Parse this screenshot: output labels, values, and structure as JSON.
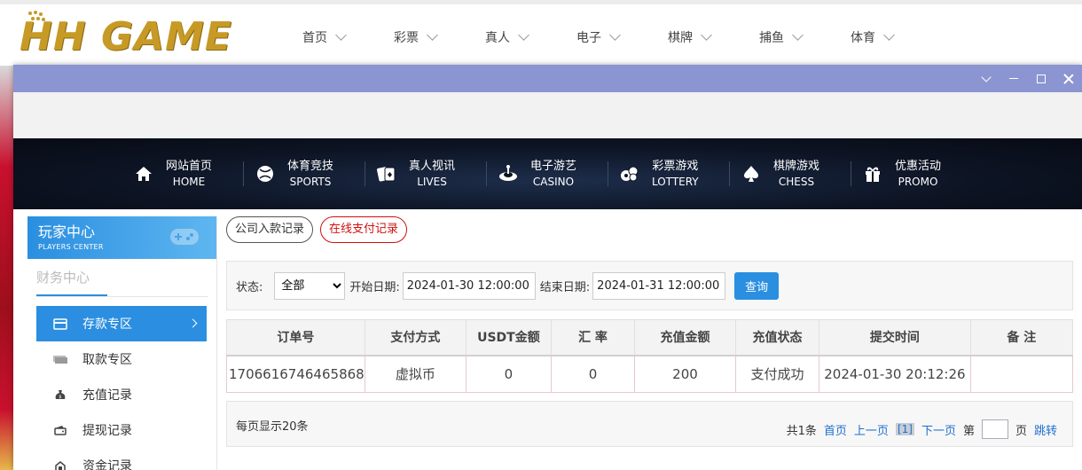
{
  "header": {
    "logo_text": "HH GAME",
    "nav": [
      "首页",
      "彩票",
      "真人",
      "电子",
      "棋牌",
      "捕鱼",
      "体育"
    ]
  },
  "main_nav": [
    {
      "cn": "网站首页",
      "en": "HOME",
      "icon": "home-icon"
    },
    {
      "cn": "体育竞技",
      "en": "SPORTS",
      "icon": "ball-icon"
    },
    {
      "cn": "真人视讯",
      "en": "LIVES",
      "icon": "cards-icon"
    },
    {
      "cn": "电子游艺",
      "en": "CASINO",
      "icon": "slot-icon"
    },
    {
      "cn": "彩票游戏",
      "en": "LOTTERY",
      "icon": "lottery-balls-icon"
    },
    {
      "cn": "棋牌游戏",
      "en": "CHESS",
      "icon": "spade-icon"
    },
    {
      "cn": "优惠活动",
      "en": "PROMO",
      "icon": "gift-icon"
    }
  ],
  "sidebar": {
    "title": "玩家中心",
    "subtitle": "PLAYERS CENTER",
    "section": "财务中心",
    "items": [
      {
        "label": "存款专区",
        "icon": "card-icon"
      },
      {
        "label": "取款专区",
        "icon": "money-icon"
      },
      {
        "label": "充值记录",
        "icon": "bag-icon"
      },
      {
        "label": "提现记录",
        "icon": "wallet-icon"
      },
      {
        "label": "资金记录",
        "icon": "coins-icon"
      }
    ]
  },
  "tabs": [
    "公司入款记录",
    "在线支付记录"
  ],
  "filter": {
    "status_label": "状态:",
    "status_value": "全部",
    "start_label": "开始日期:",
    "start_value": "2024-01-30 12:00:00",
    "end_label": "结束日期:",
    "end_value": "2024-01-31 12:00:00",
    "query_label": "查询"
  },
  "table": {
    "headers": [
      "订单号",
      "支付方式",
      "USDT金额",
      "汇 率",
      "充值金额",
      "充值状态",
      "提交时间",
      "备 注"
    ],
    "rows": [
      [
        "1706616746465868",
        "虚拟币",
        "0",
        "0",
        "200",
        "支付成功",
        "2024-01-30 20:12:26",
        ""
      ]
    ]
  },
  "pager": {
    "per_page": "每页显示20条",
    "total": "共1条",
    "first": "首页",
    "prev": "上一页",
    "current": "[1]",
    "next": "下一页",
    "page_prefix": "第",
    "page_suffix": "页",
    "jump": "跳转"
  },
  "colors": {
    "accent": "#2a8fe0",
    "titlebar": "#8b95d1",
    "logo": "#c79a26"
  }
}
